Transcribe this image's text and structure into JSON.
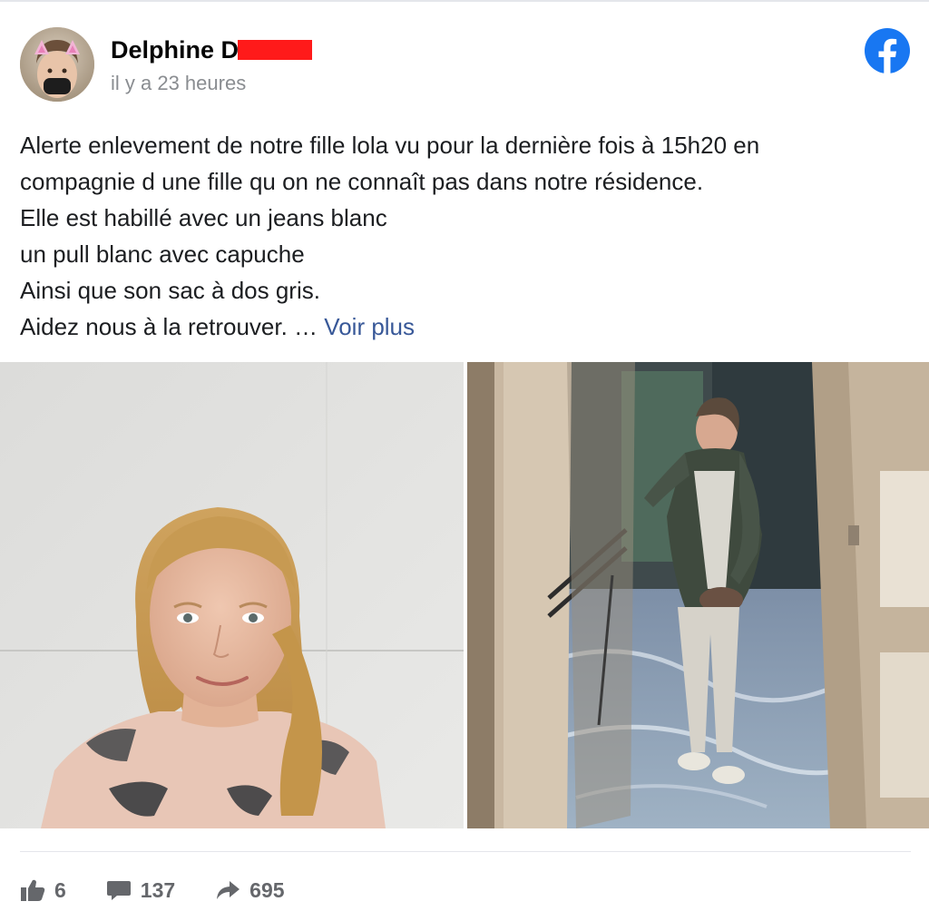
{
  "post": {
    "author_name": "Delphine D",
    "timestamp": "il y a 23 heures",
    "text_lines": [
      "Alerte enlevement de notre fille lola vu pour la dernière fois à 15h20 en",
      "compagnie d une fille qu on ne connaît pas dans notre résidence.",
      "Elle est habillé avec un jeans blanc",
      "un pull blanc avec capuche",
      "Ainsi que son sac à dos gris.",
      "Aidez nous à la retrouver. … "
    ],
    "see_more_label": "Voir plus"
  },
  "stats": {
    "likes": "6",
    "comments": "137",
    "shares": "695"
  },
  "icons": {
    "platform": "facebook-icon",
    "like": "thumbs-up-icon",
    "comment": "comment-bubble-icon",
    "share": "share-arrow-icon"
  },
  "colors": {
    "facebook_blue": "#1877f2",
    "link_blue": "#385898",
    "muted_gray": "#8a8d91",
    "redaction_red": "#ff1a1a"
  }
}
